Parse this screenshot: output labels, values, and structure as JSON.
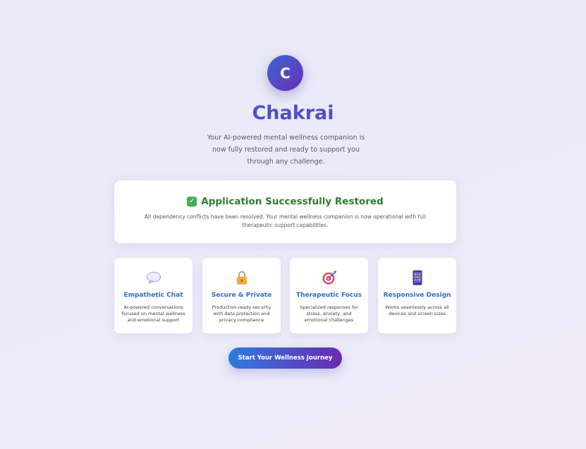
{
  "brand": {
    "logo_letter": "C",
    "name": "Chakrai"
  },
  "tagline": "Your AI-powered mental wellness companion is now fully restored and ready to support you through any challenge.",
  "status": {
    "title": "Application Successfully Restored",
    "description": "All dependency conflicts have been resolved. Your mental wellness companion is now operational with full therapeutic support capabilities.",
    "icon": "check-box-icon"
  },
  "features": [
    {
      "icon": "speech-bubble-icon",
      "title": "Empathetic Chat",
      "description": "AI-powered conversations focused on mental wellness and emotional support"
    },
    {
      "icon": "padlock-icon",
      "title": "Secure & Private",
      "description": "Production-ready security with data protection and privacy compliance"
    },
    {
      "icon": "target-icon",
      "title": "Therapeutic Focus",
      "description": "Specialized responses for stress, anxiety, and emotional challenges"
    },
    {
      "icon": "mobile-phone-icon",
      "title": "Responsive Design",
      "description": "Works seamlessly across all devices and screen sizes"
    }
  ],
  "cta": {
    "label": "Start Your Wellness Journey"
  },
  "colors": {
    "accent_blue": "#2d7be0",
    "accent_purple": "#6a2bb0",
    "success_green": "#2e7d32",
    "feature_title_blue": "#2a6fc9"
  }
}
